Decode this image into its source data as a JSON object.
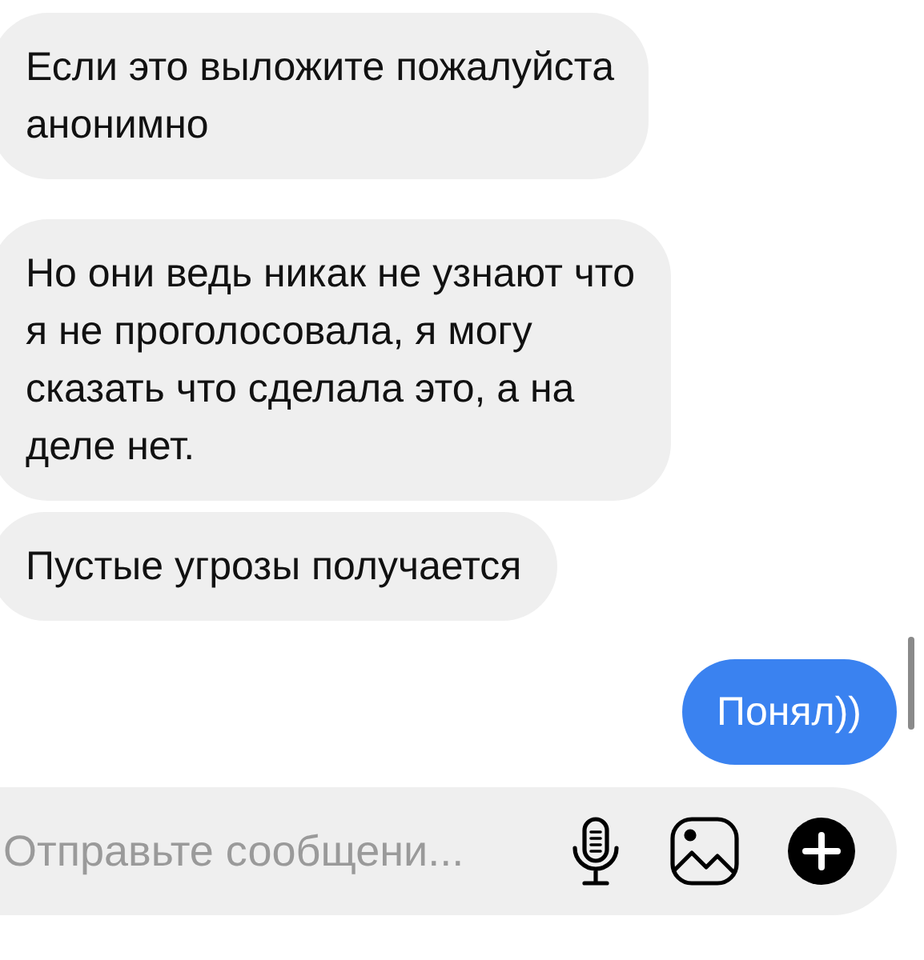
{
  "messages": [
    {
      "kind": "incoming",
      "text": "Если это выложите пожалуйста\nанонимно"
    },
    {
      "kind": "incoming",
      "text": "Но они ведь никак не узнают что\nя не проголосовала, я могу\nсказать что сделала это, а на\nделе нет."
    },
    {
      "kind": "incoming",
      "text": "Пустые угрозы получается"
    },
    {
      "kind": "outgoing",
      "text": "Понял))"
    }
  ],
  "composer": {
    "placeholder": "Отправьте сообщени..."
  }
}
